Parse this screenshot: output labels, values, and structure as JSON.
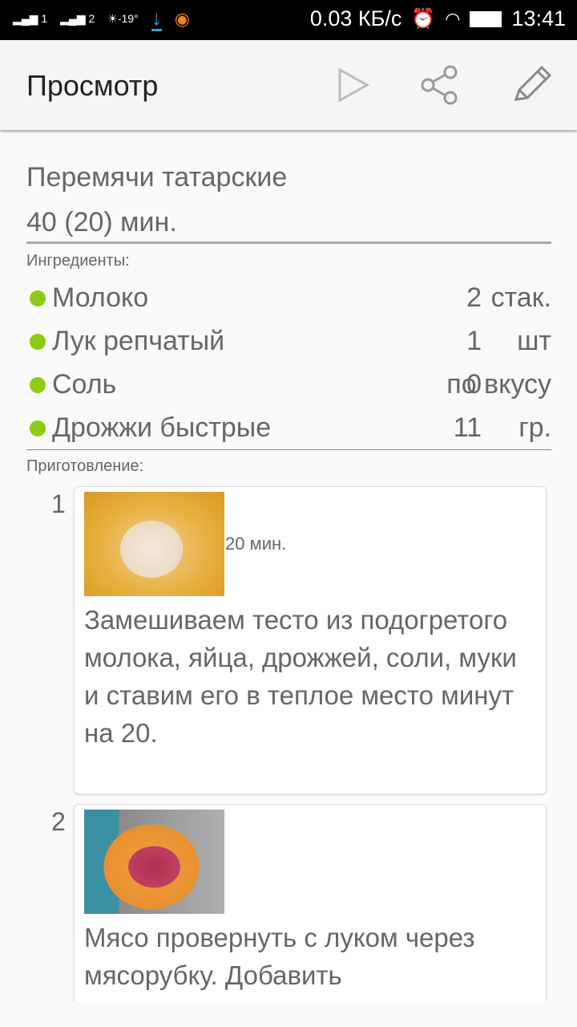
{
  "status_bar": {
    "signal1": "1",
    "signal2": "2",
    "temperature": "-19°",
    "network_speed": "0.03 КБ/с",
    "time": "13:41"
  },
  "app_bar": {
    "title": "Просмотр"
  },
  "recipe": {
    "title": "Перемячи татарские",
    "time": "40 (20) мин.",
    "ingredients_label": "Ингредиенты:",
    "ingredients": [
      {
        "name": "Молоко",
        "qty": "2",
        "unit": "стак."
      },
      {
        "name": "Лук репчатый",
        "qty": "1",
        "unit": "шт"
      },
      {
        "name": "Соль",
        "qty": "0",
        "unit": "по вкусу"
      },
      {
        "name": "Дрожжи быстрые",
        "qty": "11",
        "unit": "гр."
      }
    ],
    "steps_label": "Приготовление:",
    "steps": [
      {
        "number": "1",
        "time": "20 мин.",
        "text": "Замешиваем тесто из подогретого молока, яйца, дрожжей, соли, муки и ставим его в теплое место минут на 20."
      },
      {
        "number": "2",
        "time": "",
        "text": "Мясо провернуть с луком через мясорубку. Добавить"
      }
    ]
  },
  "colors": {
    "bullet": "#8ccc14",
    "status_accent": "#33a0e0"
  }
}
